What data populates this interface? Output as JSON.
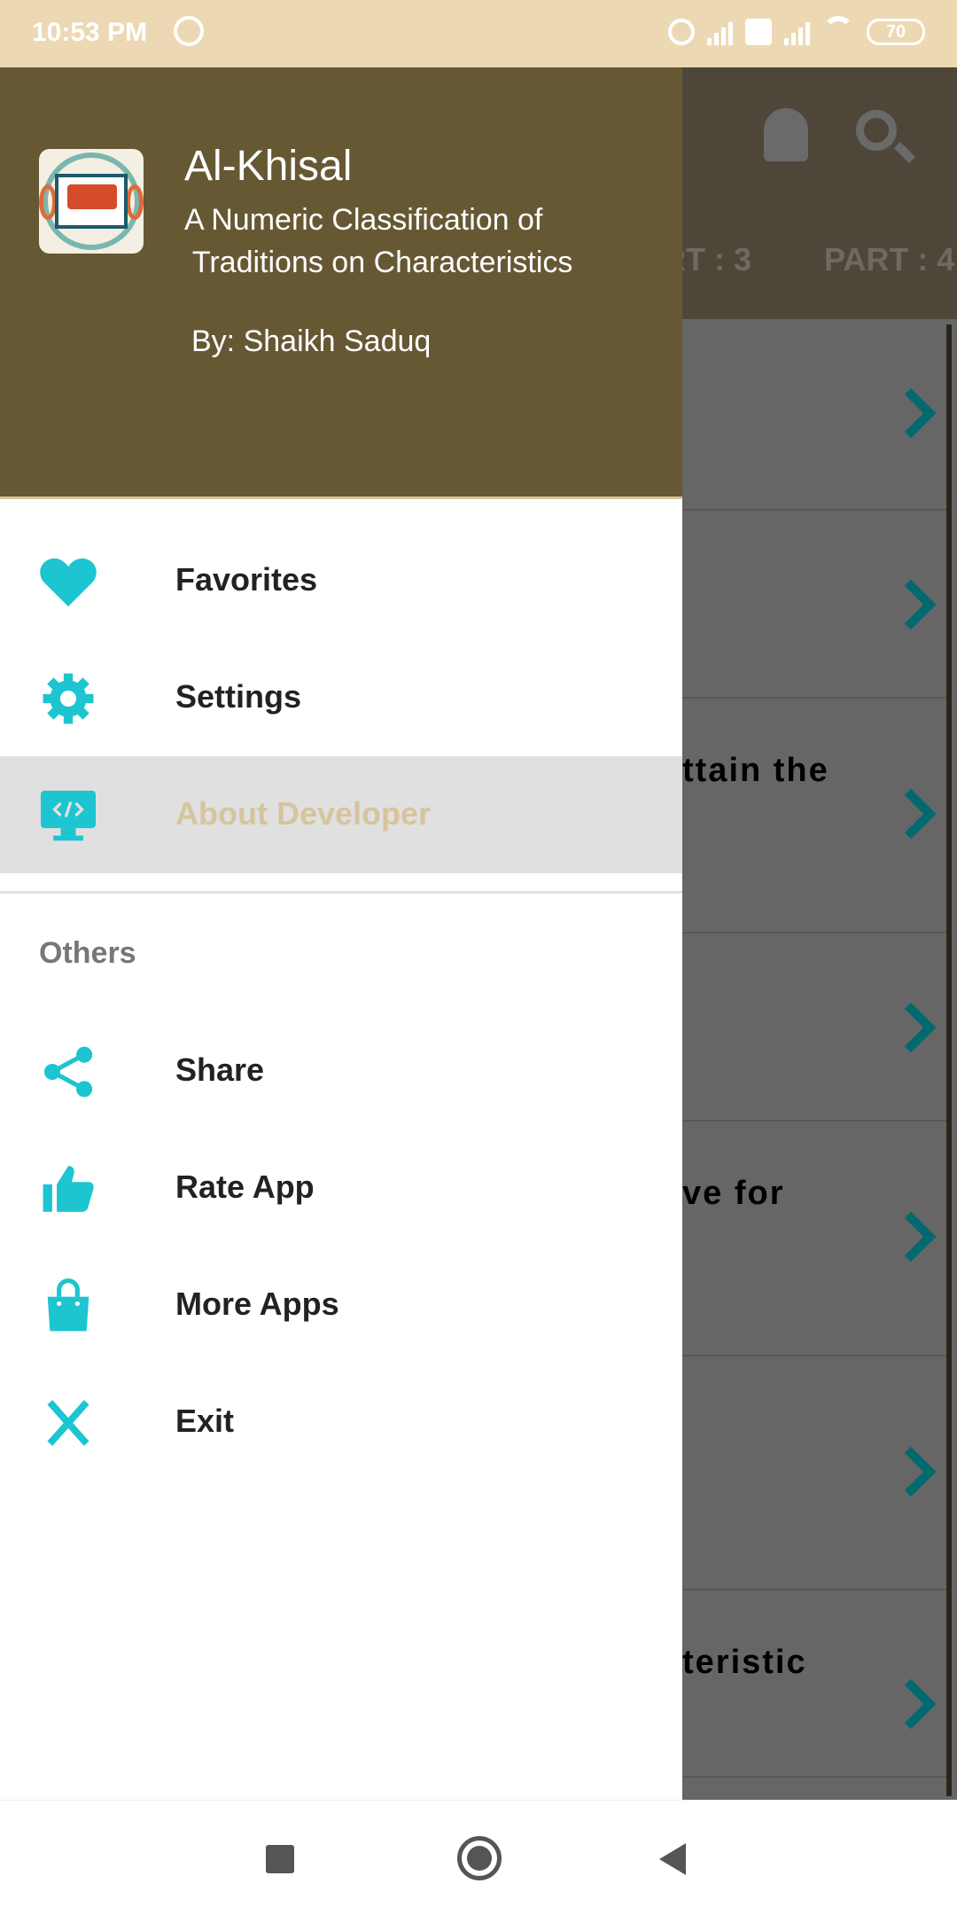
{
  "status_bar": {
    "time": "10:53 PM",
    "battery": "70",
    "icons": [
      "whatsapp-icon",
      "alarm-icon",
      "signal-icon",
      "volte-icon",
      "signal-icon",
      "wifi-icon",
      "battery-icon"
    ]
  },
  "background": {
    "tabs": [
      "RT : 3",
      "PART : 4"
    ],
    "rows": [
      "",
      "",
      "ttain the",
      "",
      "ve for",
      "",
      "teristic"
    ],
    "icons": [
      "bell-icon",
      "search-icon"
    ]
  },
  "drawer": {
    "title": "Al-Khisal",
    "subtitle": "A Numeric Classification of\n Traditions on Characteristics",
    "author": "By: Shaikh Saduq",
    "items": [
      {
        "label": "Favorites",
        "icon": "heart-icon"
      },
      {
        "label": "Settings",
        "icon": "gear-icon"
      },
      {
        "label": "About Developer",
        "icon": "monitor-code-icon",
        "selected": true
      }
    ],
    "section": "Others",
    "others": [
      {
        "label": "Share",
        "icon": "share-icon"
      },
      {
        "label": "Rate App",
        "icon": "thumbs-up-icon"
      },
      {
        "label": "More Apps",
        "icon": "shopping-bag-icon"
      },
      {
        "label": "Exit",
        "icon": "close-icon"
      }
    ]
  },
  "colors": {
    "accent": "#1cc5cf",
    "header": "#665833",
    "status_bar": "#ecd9b4",
    "selected_text": "#d6c49c"
  }
}
